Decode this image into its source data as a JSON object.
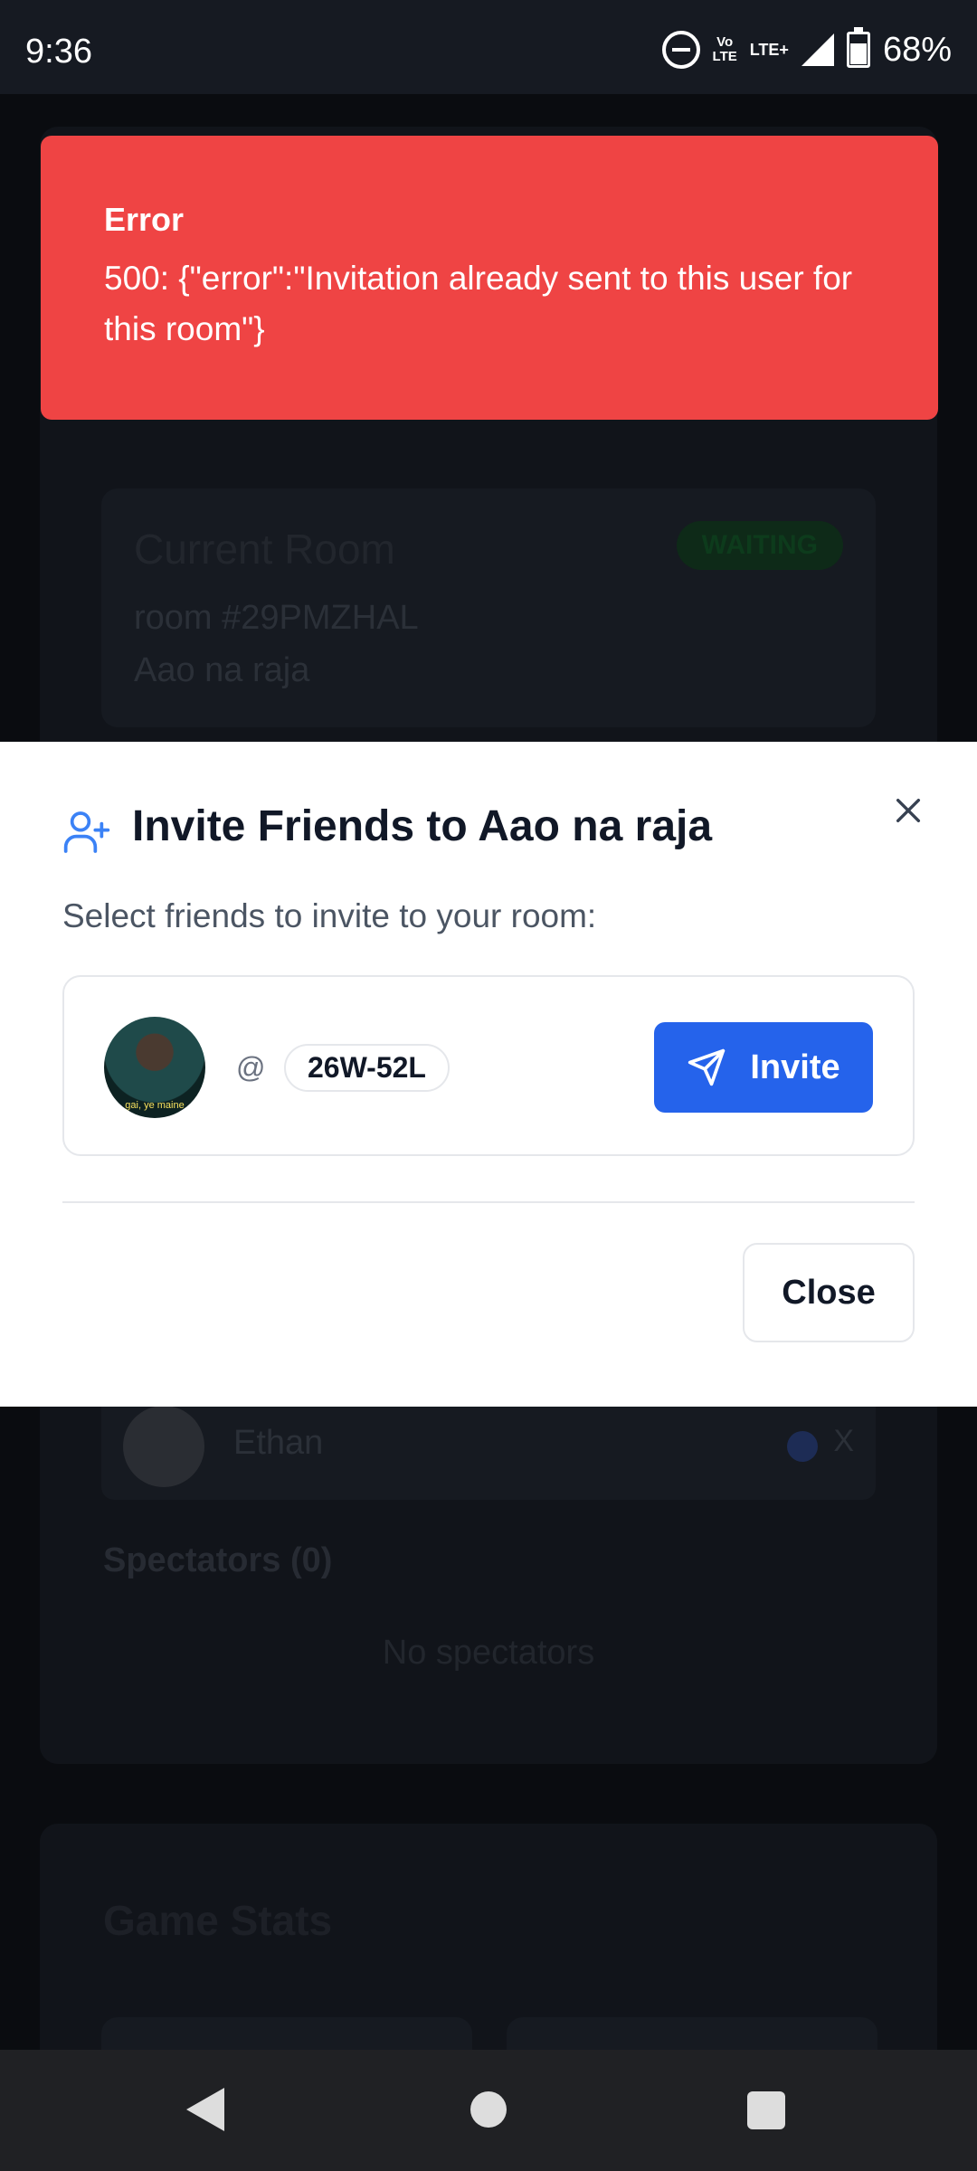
{
  "status_bar": {
    "time": "9:36",
    "volte_top": "Vo",
    "volte_bottom": "LTE",
    "lte": "LTE+",
    "battery": "68%"
  },
  "background": {
    "room": {
      "title": "Current Room",
      "status": "WAITING",
      "code": "room #29PMZHAL",
      "name": "Aao na raja"
    },
    "player": {
      "name": "Ethan",
      "remove": "X"
    },
    "spectators_heading": "Spectators (0)",
    "no_spectators": "No spectators",
    "stats_title": "Game Stats"
  },
  "toast": {
    "title": "Error",
    "message": "500: {\"error\":\"Invitation already sent to this user for this room\"}",
    "color": "#ef4444"
  },
  "modal": {
    "title": "Invite Friends to Aao na raja",
    "subtitle": "Select friends to invite to your room:",
    "friends": [
      {
        "at": "@",
        "handle": "26W-52L",
        "avatar_caption": "gai, ye maine",
        "invite_label": "Invite"
      }
    ],
    "close_label": "Close",
    "accent": "#2563eb"
  },
  "icons": {
    "invite_icon": "user-plus-icon",
    "close_icon": "close-icon",
    "send_icon": "send-icon"
  }
}
